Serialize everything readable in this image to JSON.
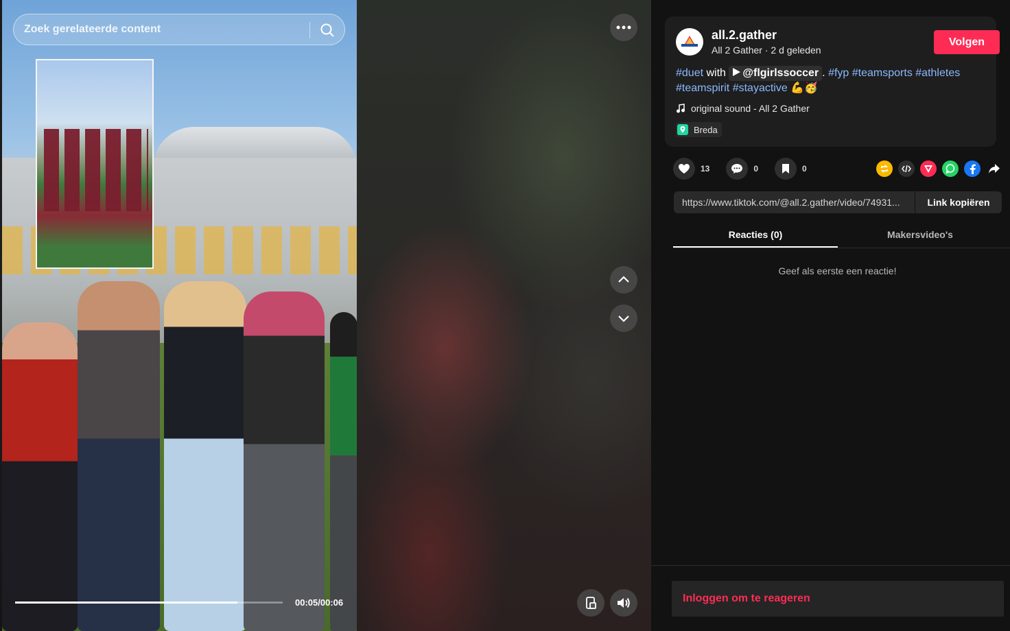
{
  "search": {
    "placeholder": "Zoek gerelateerde content"
  },
  "player": {
    "time": "00:05/00:06",
    "progress": 0.83
  },
  "author": {
    "username": "all.2.gather",
    "display_name": "All 2 Gather",
    "posted": "2 d geleden",
    "separator": "·",
    "follow_label": "Volgen"
  },
  "caption": {
    "tag_duet": "#duet",
    "with_text": "with",
    "mention": "@flgirlssoccer",
    "after_mention": ".",
    "tags": [
      "#fyp",
      "#teamsports",
      "#athletes",
      "#teamspirit",
      "#stayactive"
    ],
    "emojis": "💪🥳"
  },
  "sound": {
    "label": "original sound - All 2 Gather"
  },
  "location": {
    "label": "Breda"
  },
  "stats": {
    "likes": "13",
    "comments": "0",
    "saves": "0"
  },
  "link": {
    "url": "https://www.tiktok.com/@all.2.gather/video/74931...",
    "copy_label": "Link kopiëren"
  },
  "tabs": [
    {
      "label": "Reacties (0)",
      "active": true
    },
    {
      "label": "Makersvideo's",
      "active": false
    }
  ],
  "comments": {
    "empty_text": "Geef als eerste een reactie!"
  },
  "footer": {
    "login_label": "Inloggen om te reageren"
  },
  "colors": {
    "accent": "#fe2c55",
    "tag": "#8bb8ff",
    "panel": "#121212"
  },
  "icons": [
    "search-icon",
    "more-icon",
    "chevron-up-icon",
    "chevron-down-icon",
    "pip-icon",
    "volume-icon",
    "heart-icon",
    "comment-icon",
    "bookmark-icon",
    "repost-icon",
    "embed-icon",
    "send-icon",
    "whatsapp-icon",
    "facebook-icon",
    "share-arrow-icon",
    "music-note-icon",
    "location-pin-icon"
  ]
}
